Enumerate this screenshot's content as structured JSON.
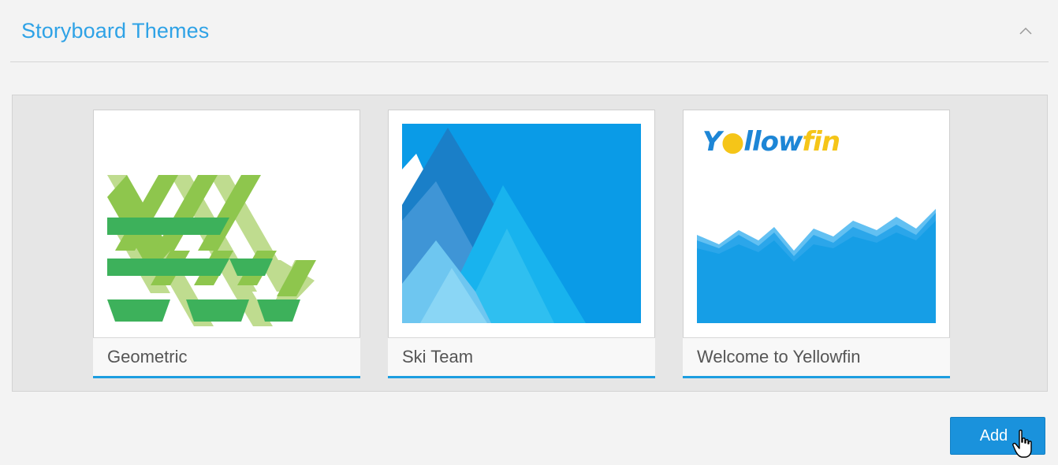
{
  "panel": {
    "title": "Storyboard Themes",
    "collapse_icon": "chevron-up-icon"
  },
  "themes": [
    {
      "label": "Geometric"
    },
    {
      "label": "Ski Team"
    },
    {
      "label": "Welcome to Yellowfin",
      "logo_part1": "Y",
      "logo_part2": "llow",
      "logo_part3": "fin"
    }
  ],
  "actions": {
    "add_label": "Add",
    "cursor_icon": "hand-pointer-icon"
  },
  "colors": {
    "accent": "#2ea2e6",
    "button": "#1a92dc",
    "card_underline": "#1d9ee0",
    "logo_blue": "#1d86d6",
    "logo_yellow": "#f5c518"
  }
}
